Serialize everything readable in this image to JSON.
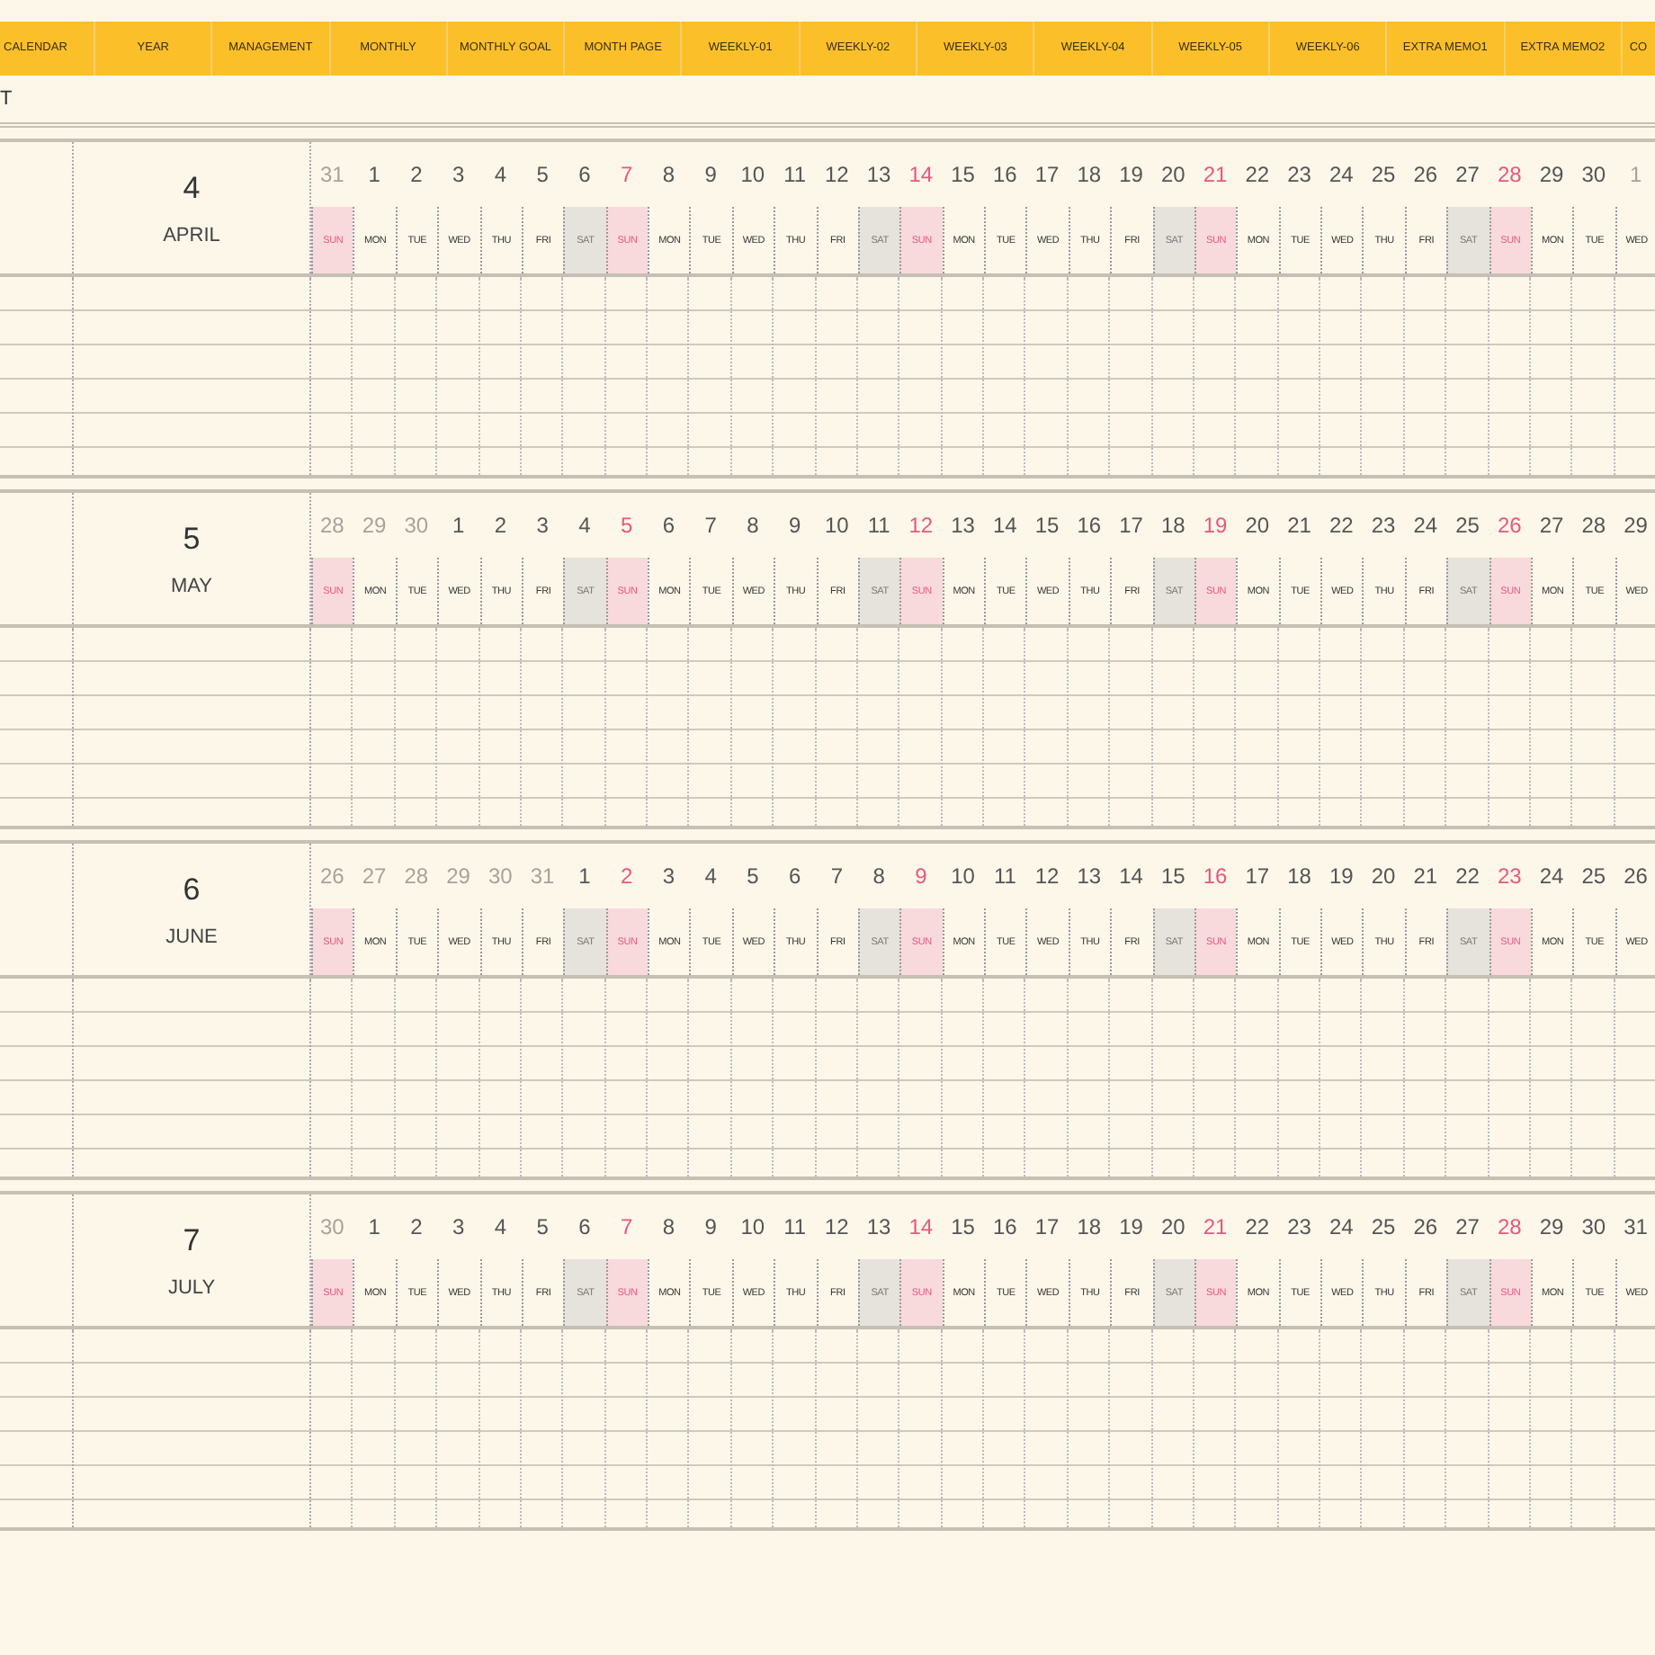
{
  "tabs": [
    {
      "label": "CALENDAR"
    },
    {
      "label": "YEAR"
    },
    {
      "label": "MANAGEMENT"
    },
    {
      "label": "MONTHLY"
    },
    {
      "label": "MONTHLY GOAL"
    },
    {
      "label": "MONTH PAGE"
    },
    {
      "label": "WEEKLY-01"
    },
    {
      "label": "WEEKLY-02"
    },
    {
      "label": "WEEKLY-03"
    },
    {
      "label": "WEEKLY-04"
    },
    {
      "label": "WEEKLY-05"
    },
    {
      "label": "WEEKLY-06"
    },
    {
      "label": "EXTRA MEMO1"
    },
    {
      "label": "EXTRA MEMO2"
    },
    {
      "label": "CO"
    }
  ],
  "page_title": "T",
  "months": [
    {
      "number": "4",
      "name": "APRIL",
      "days": [
        {
          "day": "31",
          "weekday": "SUN",
          "kind": "sun",
          "outside": true
        },
        {
          "day": "1",
          "weekday": "MON",
          "kind": "weekday",
          "outside": false
        },
        {
          "day": "2",
          "weekday": "TUE",
          "kind": "weekday",
          "outside": false
        },
        {
          "day": "3",
          "weekday": "WED",
          "kind": "weekday",
          "outside": false
        },
        {
          "day": "4",
          "weekday": "THU",
          "kind": "weekday",
          "outside": false
        },
        {
          "day": "5",
          "weekday": "FRI",
          "kind": "weekday",
          "outside": false
        },
        {
          "day": "6",
          "weekday": "SAT",
          "kind": "sat",
          "outside": false
        },
        {
          "day": "7",
          "weekday": "SUN",
          "kind": "sun",
          "outside": false
        },
        {
          "day": "8",
          "weekday": "MON",
          "kind": "weekday",
          "outside": false
        },
        {
          "day": "9",
          "weekday": "TUE",
          "kind": "weekday",
          "outside": false
        },
        {
          "day": "10",
          "weekday": "WED",
          "kind": "weekday",
          "outside": false
        },
        {
          "day": "11",
          "weekday": "THU",
          "kind": "weekday",
          "outside": false
        },
        {
          "day": "12",
          "weekday": "FRI",
          "kind": "weekday",
          "outside": false
        },
        {
          "day": "13",
          "weekday": "SAT",
          "kind": "sat",
          "outside": false
        },
        {
          "day": "14",
          "weekday": "SUN",
          "kind": "sun",
          "outside": false
        },
        {
          "day": "15",
          "weekday": "MON",
          "kind": "weekday",
          "outside": false
        },
        {
          "day": "16",
          "weekday": "TUE",
          "kind": "weekday",
          "outside": false
        },
        {
          "day": "17",
          "weekday": "WED",
          "kind": "weekday",
          "outside": false
        },
        {
          "day": "18",
          "weekday": "THU",
          "kind": "weekday",
          "outside": false
        },
        {
          "day": "19",
          "weekday": "FRI",
          "kind": "weekday",
          "outside": false
        },
        {
          "day": "20",
          "weekday": "SAT",
          "kind": "sat",
          "outside": false
        },
        {
          "day": "21",
          "weekday": "SUN",
          "kind": "sun",
          "outside": false
        },
        {
          "day": "22",
          "weekday": "MON",
          "kind": "weekday",
          "outside": false
        },
        {
          "day": "23",
          "weekday": "TUE",
          "kind": "weekday",
          "outside": false
        },
        {
          "day": "24",
          "weekday": "WED",
          "kind": "weekday",
          "outside": false
        },
        {
          "day": "25",
          "weekday": "THU",
          "kind": "weekday",
          "outside": false
        },
        {
          "day": "26",
          "weekday": "FRI",
          "kind": "weekday",
          "outside": false
        },
        {
          "day": "27",
          "weekday": "SAT",
          "kind": "sat",
          "outside": false
        },
        {
          "day": "28",
          "weekday": "SUN",
          "kind": "sun",
          "outside": false
        },
        {
          "day": "29",
          "weekday": "MON",
          "kind": "weekday",
          "outside": false
        },
        {
          "day": "30",
          "weekday": "TUE",
          "kind": "weekday",
          "outside": false
        },
        {
          "day": "1",
          "weekday": "WED",
          "kind": "weekday",
          "outside": true
        }
      ]
    },
    {
      "number": "5",
      "name": "MAY",
      "days": [
        {
          "day": "28",
          "weekday": "SUN",
          "kind": "sun",
          "outside": true
        },
        {
          "day": "29",
          "weekday": "MON",
          "kind": "weekday",
          "outside": true
        },
        {
          "day": "30",
          "weekday": "TUE",
          "kind": "weekday",
          "outside": true
        },
        {
          "day": "1",
          "weekday": "WED",
          "kind": "weekday",
          "outside": false
        },
        {
          "day": "2",
          "weekday": "THU",
          "kind": "weekday",
          "outside": false
        },
        {
          "day": "3",
          "weekday": "FRI",
          "kind": "weekday",
          "outside": false
        },
        {
          "day": "4",
          "weekday": "SAT",
          "kind": "sat",
          "outside": false
        },
        {
          "day": "5",
          "weekday": "SUN",
          "kind": "sun",
          "outside": false
        },
        {
          "day": "6",
          "weekday": "MON",
          "kind": "weekday",
          "outside": false
        },
        {
          "day": "7",
          "weekday": "TUE",
          "kind": "weekday",
          "outside": false
        },
        {
          "day": "8",
          "weekday": "WED",
          "kind": "weekday",
          "outside": false
        },
        {
          "day": "9",
          "weekday": "THU",
          "kind": "weekday",
          "outside": false
        },
        {
          "day": "10",
          "weekday": "FRI",
          "kind": "weekday",
          "outside": false
        },
        {
          "day": "11",
          "weekday": "SAT",
          "kind": "sat",
          "outside": false
        },
        {
          "day": "12",
          "weekday": "SUN",
          "kind": "sun",
          "outside": false
        },
        {
          "day": "13",
          "weekday": "MON",
          "kind": "weekday",
          "outside": false
        },
        {
          "day": "14",
          "weekday": "TUE",
          "kind": "weekday",
          "outside": false
        },
        {
          "day": "15",
          "weekday": "WED",
          "kind": "weekday",
          "outside": false
        },
        {
          "day": "16",
          "weekday": "THU",
          "kind": "weekday",
          "outside": false
        },
        {
          "day": "17",
          "weekday": "FRI",
          "kind": "weekday",
          "outside": false
        },
        {
          "day": "18",
          "weekday": "SAT",
          "kind": "sat",
          "outside": false
        },
        {
          "day": "19",
          "weekday": "SUN",
          "kind": "sun",
          "outside": false
        },
        {
          "day": "20",
          "weekday": "MON",
          "kind": "weekday",
          "outside": false
        },
        {
          "day": "21",
          "weekday": "TUE",
          "kind": "weekday",
          "outside": false
        },
        {
          "day": "22",
          "weekday": "WED",
          "kind": "weekday",
          "outside": false
        },
        {
          "day": "23",
          "weekday": "THU",
          "kind": "weekday",
          "outside": false
        },
        {
          "day": "24",
          "weekday": "FRI",
          "kind": "weekday",
          "outside": false
        },
        {
          "day": "25",
          "weekday": "SAT",
          "kind": "sat",
          "outside": false
        },
        {
          "day": "26",
          "weekday": "SUN",
          "kind": "sun",
          "outside": false
        },
        {
          "day": "27",
          "weekday": "MON",
          "kind": "weekday",
          "outside": false
        },
        {
          "day": "28",
          "weekday": "TUE",
          "kind": "weekday",
          "outside": false
        },
        {
          "day": "29",
          "weekday": "WED",
          "kind": "weekday",
          "outside": false
        }
      ]
    },
    {
      "number": "6",
      "name": "JUNE",
      "days": [
        {
          "day": "26",
          "weekday": "SUN",
          "kind": "sun",
          "outside": true
        },
        {
          "day": "27",
          "weekday": "MON",
          "kind": "weekday",
          "outside": true
        },
        {
          "day": "28",
          "weekday": "TUE",
          "kind": "weekday",
          "outside": true
        },
        {
          "day": "29",
          "weekday": "WED",
          "kind": "weekday",
          "outside": true
        },
        {
          "day": "30",
          "weekday": "THU",
          "kind": "weekday",
          "outside": true
        },
        {
          "day": "31",
          "weekday": "FRI",
          "kind": "weekday",
          "outside": true
        },
        {
          "day": "1",
          "weekday": "SAT",
          "kind": "sat",
          "outside": false
        },
        {
          "day": "2",
          "weekday": "SUN",
          "kind": "sun",
          "outside": false
        },
        {
          "day": "3",
          "weekday": "MON",
          "kind": "weekday",
          "outside": false
        },
        {
          "day": "4",
          "weekday": "TUE",
          "kind": "weekday",
          "outside": false
        },
        {
          "day": "5",
          "weekday": "WED",
          "kind": "weekday",
          "outside": false
        },
        {
          "day": "6",
          "weekday": "THU",
          "kind": "weekday",
          "outside": false
        },
        {
          "day": "7",
          "weekday": "FRI",
          "kind": "weekday",
          "outside": false
        },
        {
          "day": "8",
          "weekday": "SAT",
          "kind": "sat",
          "outside": false
        },
        {
          "day": "9",
          "weekday": "SUN",
          "kind": "sun",
          "outside": false
        },
        {
          "day": "10",
          "weekday": "MON",
          "kind": "weekday",
          "outside": false
        },
        {
          "day": "11",
          "weekday": "TUE",
          "kind": "weekday",
          "outside": false
        },
        {
          "day": "12",
          "weekday": "WED",
          "kind": "weekday",
          "outside": false
        },
        {
          "day": "13",
          "weekday": "THU",
          "kind": "weekday",
          "outside": false
        },
        {
          "day": "14",
          "weekday": "FRI",
          "kind": "weekday",
          "outside": false
        },
        {
          "day": "15",
          "weekday": "SAT",
          "kind": "sat",
          "outside": false
        },
        {
          "day": "16",
          "weekday": "SUN",
          "kind": "sun",
          "outside": false
        },
        {
          "day": "17",
          "weekday": "MON",
          "kind": "weekday",
          "outside": false
        },
        {
          "day": "18",
          "weekday": "TUE",
          "kind": "weekday",
          "outside": false
        },
        {
          "day": "19",
          "weekday": "WED",
          "kind": "weekday",
          "outside": false
        },
        {
          "day": "20",
          "weekday": "THU",
          "kind": "weekday",
          "outside": false
        },
        {
          "day": "21",
          "weekday": "FRI",
          "kind": "weekday",
          "outside": false
        },
        {
          "day": "22",
          "weekday": "SAT",
          "kind": "sat",
          "outside": false
        },
        {
          "day": "23",
          "weekday": "SUN",
          "kind": "sun",
          "outside": false
        },
        {
          "day": "24",
          "weekday": "MON",
          "kind": "weekday",
          "outside": false
        },
        {
          "day": "25",
          "weekday": "TUE",
          "kind": "weekday",
          "outside": false
        },
        {
          "day": "26",
          "weekday": "WED",
          "kind": "weekday",
          "outside": false
        }
      ]
    },
    {
      "number": "7",
      "name": "JULY",
      "days": [
        {
          "day": "30",
          "weekday": "SUN",
          "kind": "sun",
          "outside": true
        },
        {
          "day": "1",
          "weekday": "MON",
          "kind": "weekday",
          "outside": false
        },
        {
          "day": "2",
          "weekday": "TUE",
          "kind": "weekday",
          "outside": false
        },
        {
          "day": "3",
          "weekday": "WED",
          "kind": "weekday",
          "outside": false
        },
        {
          "day": "4",
          "weekday": "THU",
          "kind": "weekday",
          "outside": false
        },
        {
          "day": "5",
          "weekday": "FRI",
          "kind": "weekday",
          "outside": false
        },
        {
          "day": "6",
          "weekday": "SAT",
          "kind": "sat",
          "outside": false
        },
        {
          "day": "7",
          "weekday": "SUN",
          "kind": "sun",
          "outside": false
        },
        {
          "day": "8",
          "weekday": "MON",
          "kind": "weekday",
          "outside": false
        },
        {
          "day": "9",
          "weekday": "TUE",
          "kind": "weekday",
          "outside": false
        },
        {
          "day": "10",
          "weekday": "WED",
          "kind": "weekday",
          "outside": false
        },
        {
          "day": "11",
          "weekday": "THU",
          "kind": "weekday",
          "outside": false
        },
        {
          "day": "12",
          "weekday": "FRI",
          "kind": "weekday",
          "outside": false
        },
        {
          "day": "13",
          "weekday": "SAT",
          "kind": "sat",
          "outside": false
        },
        {
          "day": "14",
          "weekday": "SUN",
          "kind": "sun",
          "outside": false
        },
        {
          "day": "15",
          "weekday": "MON",
          "kind": "weekday",
          "outside": false
        },
        {
          "day": "16",
          "weekday": "TUE",
          "kind": "weekday",
          "outside": false
        },
        {
          "day": "17",
          "weekday": "WED",
          "kind": "weekday",
          "outside": false
        },
        {
          "day": "18",
          "weekday": "THU",
          "kind": "weekday",
          "outside": false
        },
        {
          "day": "19",
          "weekday": "FRI",
          "kind": "weekday",
          "outside": false
        },
        {
          "day": "20",
          "weekday": "SAT",
          "kind": "sat",
          "outside": false
        },
        {
          "day": "21",
          "weekday": "SUN",
          "kind": "sun",
          "outside": false
        },
        {
          "day": "22",
          "weekday": "MON",
          "kind": "weekday",
          "outside": false
        },
        {
          "day": "23",
          "weekday": "TUE",
          "kind": "weekday",
          "outside": false
        },
        {
          "day": "24",
          "weekday": "WED",
          "kind": "weekday",
          "outside": false
        },
        {
          "day": "25",
          "weekday": "THU",
          "kind": "weekday",
          "outside": false
        },
        {
          "day": "26",
          "weekday": "FRI",
          "kind": "weekday",
          "outside": false
        },
        {
          "day": "27",
          "weekday": "SAT",
          "kind": "sat",
          "outside": false
        },
        {
          "day": "28",
          "weekday": "SUN",
          "kind": "sun",
          "outside": false
        },
        {
          "day": "29",
          "weekday": "MON",
          "kind": "weekday",
          "outside": false
        },
        {
          "day": "30",
          "weekday": "TUE",
          "kind": "weekday",
          "outside": false
        },
        {
          "day": "31",
          "weekday": "WED",
          "kind": "weekday",
          "outside": false
        }
      ]
    }
  ]
}
